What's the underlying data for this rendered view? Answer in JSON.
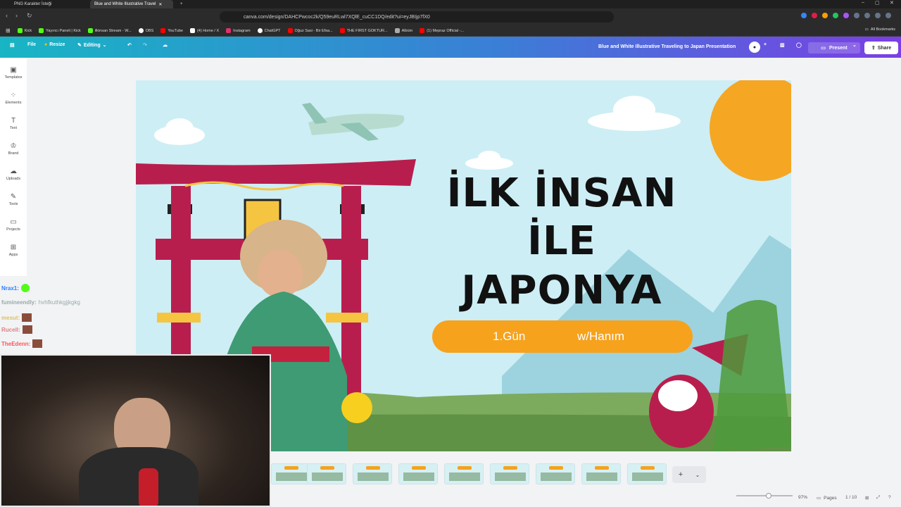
{
  "browser": {
    "tabs": [
      {
        "label": "PNG Karakter İsteği"
      },
      {
        "label": "Blue and White Illustrative Travel"
      }
    ],
    "url": "canva.com/design/DAHCPwcoc2k/Q59euRLwl7XQlE_cuCC1DQ/edit?ui=eyJBIjp7fX0",
    "bookmarks": [
      {
        "label": "Kick",
        "color": "#53fc18"
      },
      {
        "label": "Yayıncı Paneli | Kick",
        "color": "#53fc18"
      },
      {
        "label": "ilkinsan Stream - W...",
        "color": "#53fc18"
      },
      {
        "label": "OBS",
        "color": "#ffffff"
      },
      {
        "label": "YouTube",
        "color": "#ff0000"
      },
      {
        "label": "(4) Home / X",
        "color": "#ffffff"
      },
      {
        "label": "Instagram",
        "color": "#e1306c"
      },
      {
        "label": "ChatGPT",
        "color": "#ffffff"
      },
      {
        "label": "Oğuz Sasi - Bir Efsa...",
        "color": "#ff0000"
      },
      {
        "label": "THE FIRST GOKTUR...",
        "color": "#ff0000"
      },
      {
        "label": "Albüm",
        "color": "#aaaaaa"
      },
      {
        "label": "(1) Mepraz Official -...",
        "color": "#ff0000"
      }
    ],
    "all_bookmarks": "All Bookmarks"
  },
  "canva": {
    "file": "File",
    "resize": "Resize",
    "editing": "Editing",
    "design_title": "Blue and White Illustrative Traveling to Japan Presentation",
    "present": "Present",
    "share": "Share"
  },
  "sidebar": [
    {
      "label": "Templates",
      "icon": "▣"
    },
    {
      "label": "Elements",
      "icon": "⁘"
    },
    {
      "label": "Text",
      "icon": "T"
    },
    {
      "label": "Brand",
      "icon": "♔"
    },
    {
      "label": "Uploads",
      "icon": "☁"
    },
    {
      "label": "Tools",
      "icon": "✎"
    },
    {
      "label": "Projects",
      "icon": "▭"
    },
    {
      "label": "Apps",
      "icon": "⊞"
    }
  ],
  "chat": [
    {
      "user": "Nrax1:",
      "msg": "",
      "color": "#2a7fff"
    },
    {
      "user": "fumineendly:",
      "msg": "hvhfkuthkgjjkgkg",
      "color": "#9aa"
    },
    {
      "user": "mesut:",
      "msg": "",
      "color": "#e0c060"
    },
    {
      "user": "Rucell:",
      "msg": "",
      "color": "#e08080"
    },
    {
      "user": "TheEdenn:",
      "msg": "",
      "color": "#ff5555"
    }
  ],
  "slide": {
    "line1": "İLK İNSAN",
    "line2": "İLE",
    "line3": "JAPONYA !",
    "pill_left": "1.Gün",
    "pill_right": "w/Hanım"
  },
  "thumbnails": [
    "2",
    "3",
    "4",
    "5",
    "6",
    "7",
    "8",
    "9",
    "10"
  ],
  "status": {
    "zoom": "97%",
    "pages": "Pages",
    "page_count": "1 / 10"
  }
}
